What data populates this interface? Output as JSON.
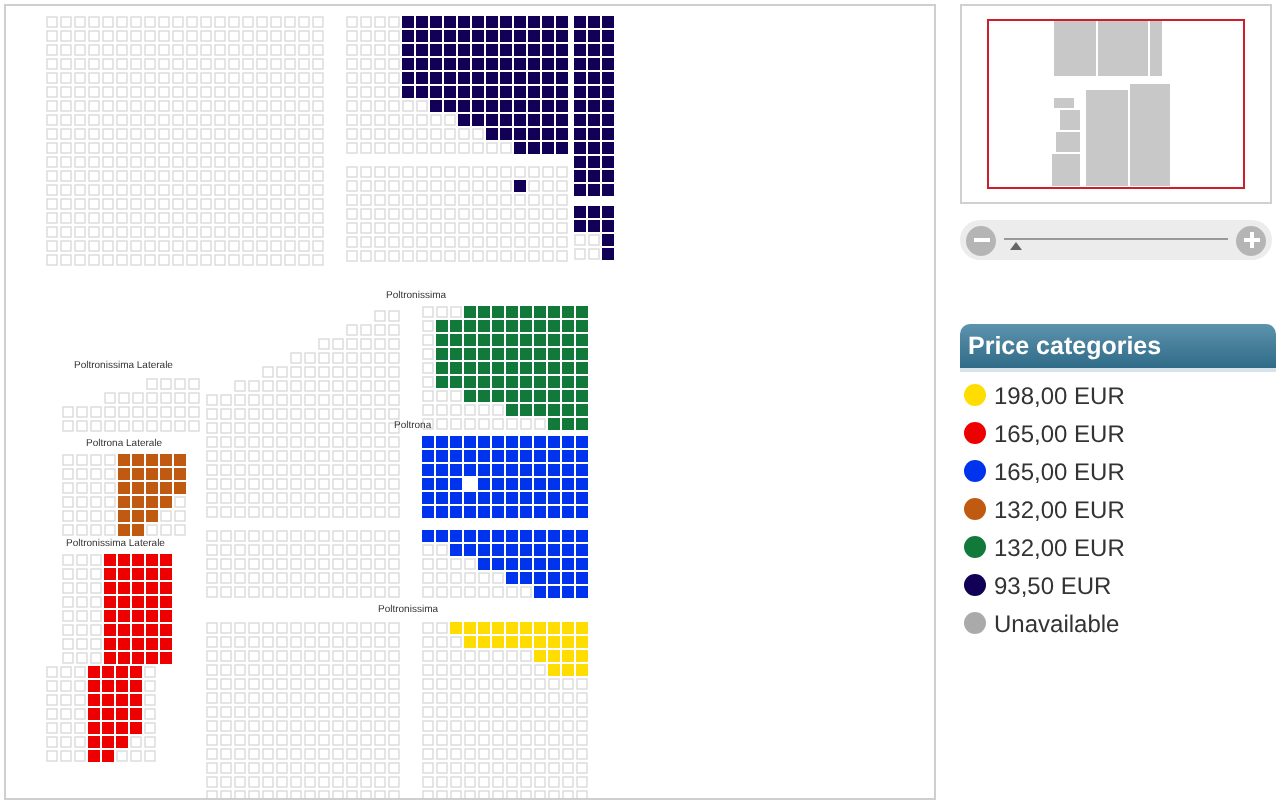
{
  "sections": [
    {
      "label": "Poltronissima"
    },
    {
      "label": "Poltronissima Laterale"
    },
    {
      "label": "Poltrona"
    },
    {
      "label": "Poltrona Laterale"
    },
    {
      "label": "Poltronissima Laterale"
    },
    {
      "label": "Poltronissima"
    }
  ],
  "zoom": {
    "level": 0.05
  },
  "legend": {
    "title": "Price categories",
    "items": [
      {
        "label": "198,00 EUR",
        "color": "#ffdd00"
      },
      {
        "label": "165,00 EUR",
        "color": "#ee0000"
      },
      {
        "label": "165,00 EUR",
        "color": "#0033ee"
      },
      {
        "label": "132,00 EUR",
        "color": "#c05a10"
      },
      {
        "label": "132,00 EUR",
        "color": "#117a3a"
      },
      {
        "label": "93,50 EUR",
        "color": "#110055"
      },
      {
        "label": "Unavailable",
        "color": "#aaaaaa"
      }
    ]
  }
}
